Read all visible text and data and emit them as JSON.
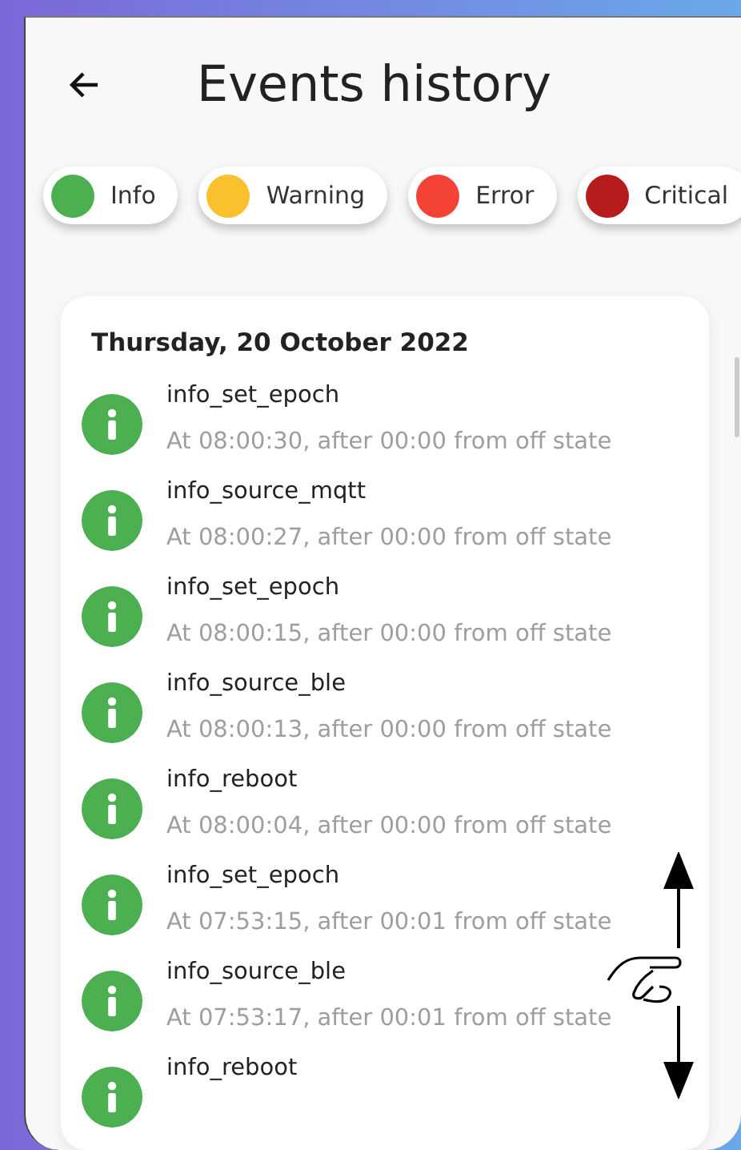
{
  "header": {
    "title": "Events history"
  },
  "filters": [
    {
      "label": "Info",
      "color": "#4caf50"
    },
    {
      "label": "Warning",
      "color": "#fbc02d"
    },
    {
      "label": "Error",
      "color": "#f44336"
    },
    {
      "label": "Critical",
      "color": "#b71c1c"
    }
  ],
  "history": {
    "date": "Thursday, 20 October 2022",
    "events": [
      {
        "kind": "info",
        "name": "info_set_epoch",
        "detail": "At 08:00:30, after 00:00 from off state"
      },
      {
        "kind": "info",
        "name": "info_source_mqtt",
        "detail": "At 08:00:27, after 00:00 from off state"
      },
      {
        "kind": "info",
        "name": "info_set_epoch",
        "detail": "At 08:00:15, after 00:00 from off state"
      },
      {
        "kind": "info",
        "name": "info_source_ble",
        "detail": "At 08:00:13, after 00:00 from off state"
      },
      {
        "kind": "info",
        "name": "info_reboot",
        "detail": "At 08:00:04, after 00:00 from off state"
      },
      {
        "kind": "info",
        "name": "info_set_epoch",
        "detail": "At 07:53:15, after 00:01 from off state"
      },
      {
        "kind": "info",
        "name": "info_source_ble",
        "detail": "At 07:53:17, after 00:01 from off state"
      },
      {
        "kind": "info",
        "name": "info_reboot"
      }
    ]
  }
}
